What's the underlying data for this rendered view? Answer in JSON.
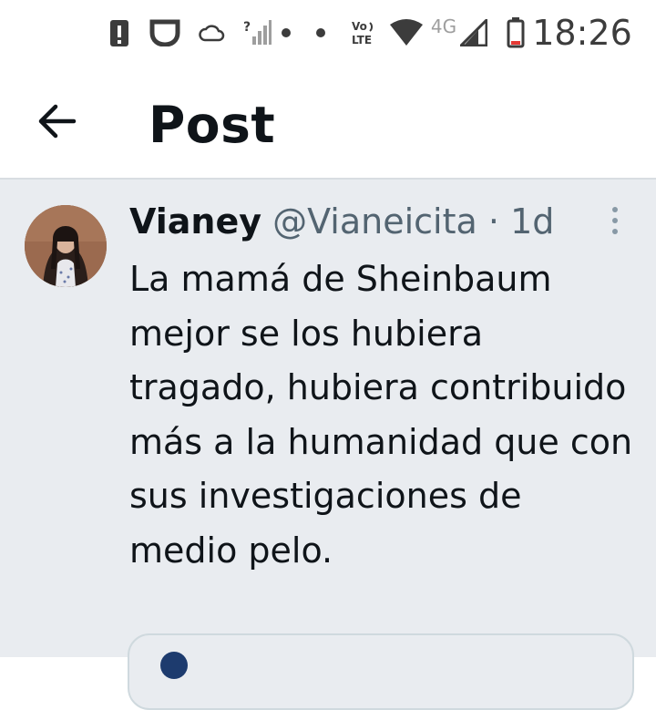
{
  "status_bar": {
    "time": "18:26",
    "network_label": "4G",
    "volte_label": "Vo\nLTE",
    "icons": [
      "alert-icon",
      "notification-shield-icon",
      "cloud-icon",
      "no-signal-icon",
      "dot-icon",
      "dot-icon",
      "volte-icon",
      "wifi-icon",
      "signal-icon",
      "battery-icon"
    ]
  },
  "header": {
    "title": "Post",
    "back_icon": "arrow-left-icon"
  },
  "post": {
    "author_name": "Vianey",
    "author_handle": "@Vianeicita",
    "separator": "·",
    "time_ago": "1d",
    "text": "La mamá de Sheinbaum mejor se los hubiera tragado, hubiera contribuido más a la humanidad que con sus investigaciones de medio pelo.",
    "more_icon": "more-vertical-icon"
  },
  "colors": {
    "post_bg": "#e9ecf0",
    "text_primary": "#0f1419",
    "text_secondary": "#536471"
  }
}
